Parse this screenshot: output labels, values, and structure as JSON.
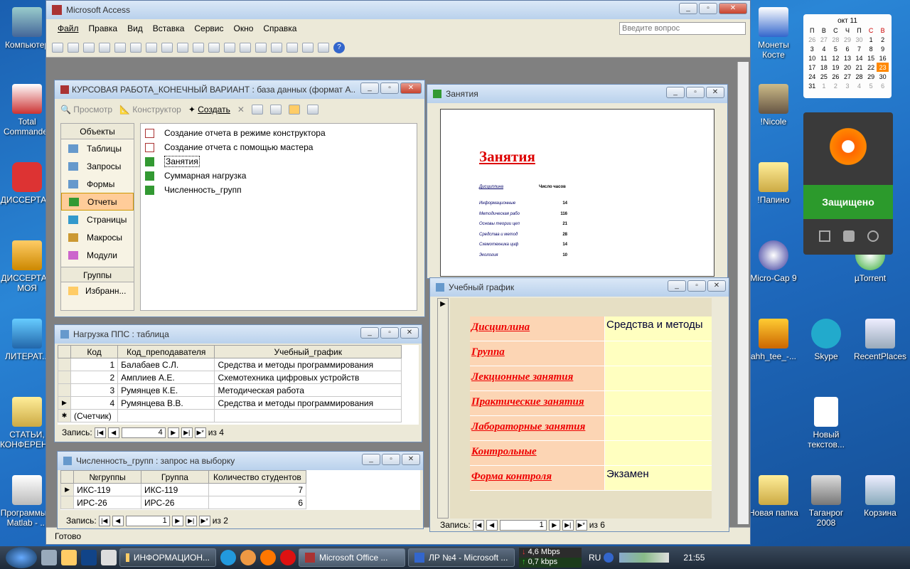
{
  "desktop": {
    "left_icons": [
      "Компьютер",
      "Total Commander",
      "ДИССЕРТА...",
      "ДИССЕРТАЦ МОЯ",
      "ЛИТЕРАТ...",
      "СТАТЬИ, КОНФЕРЕН...",
      "Программы в Matlab - ..."
    ],
    "right_icons": [
      "Монеты Косте",
      "!Nicole",
      "!Папино",
      "Micro-Cap 9",
      "µTorrent",
      "ahh_tee_-...",
      "Skype",
      "RecentPlaces",
      "Новый текстов...",
      "Новая папка",
      "Таганрог 2008",
      "Корзина"
    ]
  },
  "calendar": {
    "month": "окт 11",
    "days": [
      "П",
      "В",
      "С",
      "Ч",
      "П",
      "С",
      "В"
    ],
    "weeks": [
      [
        "26",
        "27",
        "28",
        "29",
        "30",
        "1",
        "2"
      ],
      [
        "3",
        "4",
        "5",
        "6",
        "7",
        "8",
        "9"
      ],
      [
        "10",
        "11",
        "12",
        "13",
        "14",
        "15",
        "16"
      ],
      [
        "17",
        "18",
        "19",
        "20",
        "21",
        "22",
        "23"
      ],
      [
        "24",
        "25",
        "26",
        "27",
        "28",
        "29",
        "30"
      ],
      [
        "31",
        "1",
        "2",
        "3",
        "4",
        "5",
        "6"
      ]
    ],
    "today": "23"
  },
  "avast": {
    "status": "Защищено"
  },
  "access": {
    "title": "Microsoft Access",
    "menu": [
      "Файл",
      "Правка",
      "Вид",
      "Вставка",
      "Сервис",
      "Окно",
      "Справка"
    ],
    "question_placeholder": "Введите вопрос",
    "status": "Готово"
  },
  "db": {
    "title": "КУРСОВАЯ РАБОТА_КОНЕЧНЫЙ ВАРИАНТ : база данных (формат А...",
    "toolbar": {
      "preview": "Просмотр",
      "design": "Конструктор",
      "create": "Создать"
    },
    "objects_header": "Объекты",
    "objects": [
      "Таблицы",
      "Запросы",
      "Формы",
      "Отчеты",
      "Страницы",
      "Макросы",
      "Модули"
    ],
    "groups_header": "Группы",
    "groups": [
      "Избранн..."
    ],
    "items": [
      "Создание отчета в режиме конструктора",
      "Создание отчета с помощью мастера",
      "Занятия",
      "Суммарная нагрузка",
      "Численность_групп"
    ]
  },
  "report": {
    "window_title": "Занятия",
    "heading": "Занятия",
    "col1": "Дисциплина",
    "col2": "Число часов",
    "rows": [
      [
        "Информационные",
        "14"
      ],
      [
        "Методическая рабо",
        "116"
      ],
      [
        "Основы теории цеп",
        "21"
      ],
      [
        "Средства и метод",
        "28"
      ],
      [
        "Схемотехника циф",
        "14"
      ],
      [
        "Экология",
        "10"
      ]
    ]
  },
  "load_table": {
    "title": "Нагрузка ППС : таблица",
    "headers": [
      "Код",
      "Код_преподавателя",
      "Учебный_график"
    ],
    "rows": [
      [
        "1",
        "Балабаев С.Л.",
        "Средства и методы программирования"
      ],
      [
        "2",
        "Амплиев А.Е.",
        "Схемотехника цифровых устройств"
      ],
      [
        "3",
        "Румянцев К.Е.",
        "Методическая работа"
      ],
      [
        "4",
        "Румянцева В.В.",
        "Средства и методы программирования"
      ]
    ],
    "new_row": "(Счетчик)",
    "nav_label": "Запись:",
    "nav_current": "4",
    "nav_total": "из  4"
  },
  "groups_query": {
    "title": "Численность_групп : запрос на выборку",
    "headers": [
      "№группы",
      "Группа",
      "Количество студентов"
    ],
    "rows": [
      [
        "ИКС-119",
        "ИКС-119",
        "7"
      ],
      [
        "ИРС-26",
        "ИРС-26",
        "6"
      ]
    ],
    "nav_label": "Запись:",
    "nav_current": "1",
    "nav_total": "из  2"
  },
  "schedule_form": {
    "title": "Учебный график",
    "fields": [
      [
        "Дисциплина",
        "Средства и методы"
      ],
      [
        "Группа",
        ""
      ],
      [
        "Лекционные  занятия",
        ""
      ],
      [
        "Практические  занятия",
        ""
      ],
      [
        "Лабораторные  занятия",
        ""
      ],
      [
        "Контрольные",
        ""
      ],
      [
        "Форма  контроля",
        "Экзамен"
      ]
    ],
    "nav_label": "Запись:",
    "nav_current": "1",
    "nav_total": "из  6"
  },
  "taskbar": {
    "buttons": [
      "ИНФОРМАЦИОН...",
      "Microsoft Office ...",
      "ЛР №4 - Microsoft ..."
    ],
    "net_down": "4,6 Mbps",
    "net_up": "0,7 kbps",
    "lang": "RU",
    "time": "21:55"
  }
}
